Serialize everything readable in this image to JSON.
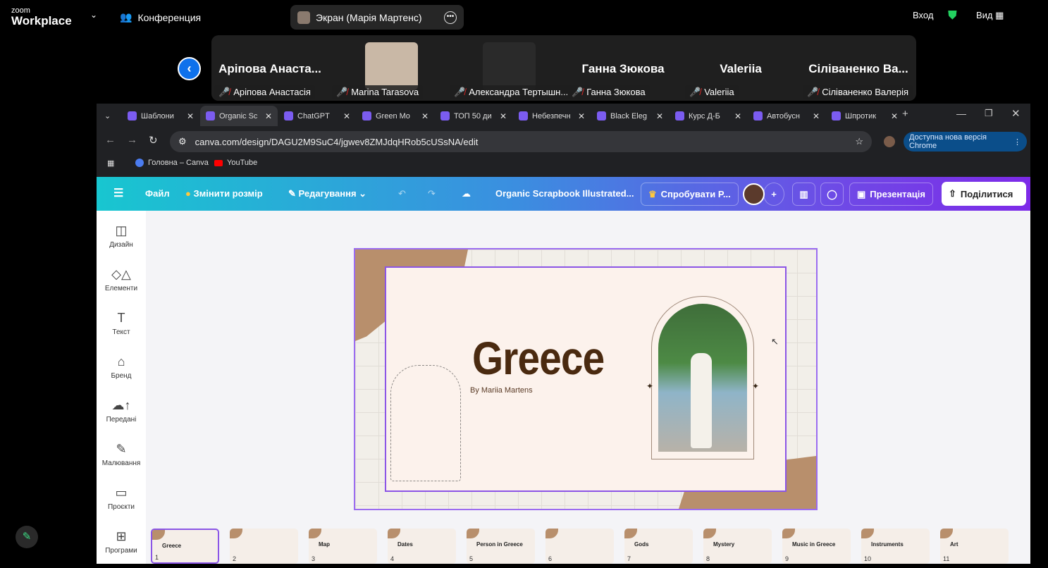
{
  "zoom": {
    "logo_small": "zoom",
    "logo_big": "Workplace",
    "meeting_label": "Конференция",
    "screen_share": "Экран (Марія Мартенс)",
    "signin": "Вход",
    "view": "Вид",
    "participants": [
      {
        "name": "Аріпова  Анаста...",
        "label": "Аріпова Анастасія",
        "photo": false
      },
      {
        "name": "",
        "label": "Marina Tarasova",
        "photo": true,
        "color": "#c9b8a6"
      },
      {
        "name": "",
        "label": "Александра Тертышн...",
        "photo": true,
        "color": "#2a2a2a"
      },
      {
        "name": "Ганна Зюкова",
        "label": "Ганна Зюкова",
        "photo": false
      },
      {
        "name": "Valeriia",
        "label": "Valeriia",
        "photo": false
      },
      {
        "name": "Сіліваненко  Ва...",
        "label": "Сіліваненко Валерія",
        "photo": false
      }
    ]
  },
  "browser": {
    "tabs": [
      {
        "label": "Шаблони"
      },
      {
        "label": "Organic Sc",
        "active": true
      },
      {
        "label": "ChatGPT"
      },
      {
        "label": "Green Mo"
      },
      {
        "label": "ТОП 50 ди"
      },
      {
        "label": "Небезпечн"
      },
      {
        "label": "Black Eleg"
      },
      {
        "label": "Курс Д-Б"
      },
      {
        "label": "Автобусн"
      },
      {
        "label": "Шпротик"
      }
    ],
    "url": "canva.com/design/DAGU2M9SuC4/jgwev8ZMJdqHRob5cUSsNA/edit",
    "update_label": "Доступна нова версія Chrome",
    "bookmarks": [
      "Головна – Canva",
      "YouTube"
    ]
  },
  "canva": {
    "menu": {
      "file": "Файл",
      "resize": "Змінити розмір",
      "editing": "Редагування",
      "doc_title": "Organic Scrapbook Illustrated...",
      "try_pro": "Спробувати P...",
      "present": "Презентація",
      "share": "Поділитися"
    },
    "sidebar": [
      "Дизайн",
      "Елементи",
      "Текст",
      "Бренд",
      "Передані",
      "Малювання",
      "Проєкти",
      "Програми"
    ],
    "slide": {
      "title": "Greece",
      "byline": "By Mariia Martens"
    },
    "thumbnails": [
      {
        "n": "1",
        "t": "Greece"
      },
      {
        "n": "2",
        "t": ""
      },
      {
        "n": "3",
        "t": "Map"
      },
      {
        "n": "4",
        "t": "Dates"
      },
      {
        "n": "5",
        "t": "Person in Greece"
      },
      {
        "n": "6",
        "t": ""
      },
      {
        "n": "7",
        "t": "Gods"
      },
      {
        "n": "8",
        "t": "Mystery"
      },
      {
        "n": "9",
        "t": "Music in Greece"
      },
      {
        "n": "10",
        "t": "Instruments"
      },
      {
        "n": "11",
        "t": "Art"
      }
    ]
  },
  "colors": {
    "canva_gradient_start": "#18c6d0",
    "canva_gradient_end": "#7d2ae8",
    "selection": "#8b55e6",
    "title_brown": "#4a2a10",
    "zoom_blue": "#0e71eb"
  }
}
